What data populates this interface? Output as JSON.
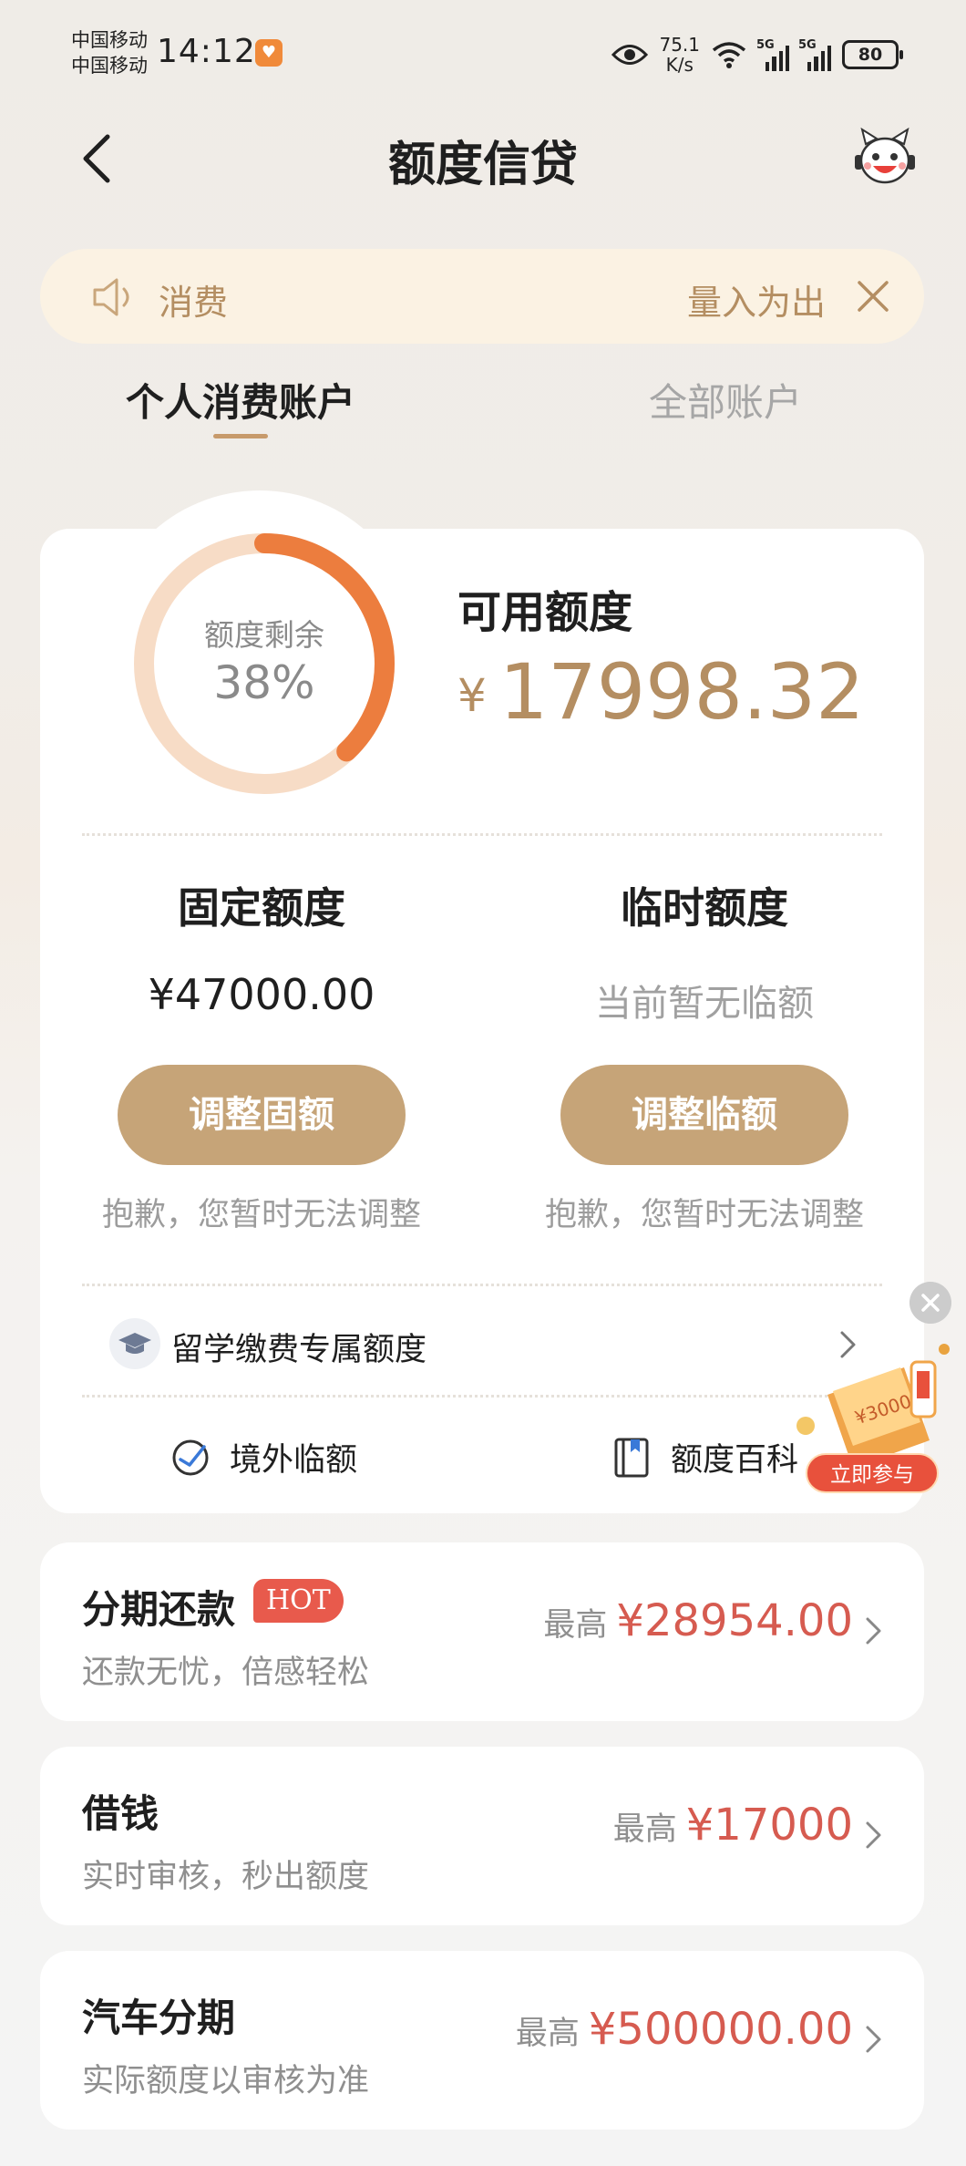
{
  "status_bar": {
    "carrier_1": "中国移动",
    "carrier_2": "中国移动",
    "time": "14:12",
    "net_speed_value": "75.1",
    "net_speed_unit": "K/s",
    "signal_1_label": "5G",
    "signal_2_label": "5G",
    "battery": "80"
  },
  "header": {
    "title": "额度信贷"
  },
  "notice": {
    "left_text": "消费",
    "right_text": "量入为出"
  },
  "tabs": [
    {
      "label": "个人消费账户",
      "active": true
    },
    {
      "label": "全部账户",
      "active": false
    }
  ],
  "credit": {
    "ring_label": "额度剩余",
    "ring_value": "38%",
    "remaining_fraction": 0.38,
    "available_label": "可用额度",
    "available_currency": "¥",
    "available_amount": "17998.32",
    "fixed": {
      "title": "固定额度",
      "value": "¥47000.00",
      "button": "调整固额",
      "note": "抱歉，您暂时无法调整"
    },
    "temporary": {
      "title": "临时额度",
      "value": "当前暂无临额",
      "button": "调整临额",
      "note": "抱歉，您暂时无法调整"
    },
    "study_label": "留学缴费专属额度",
    "tools": [
      {
        "label": "境外临额",
        "icon": "globe-plane-icon"
      },
      {
        "label": "额度百科",
        "icon": "book-icon"
      }
    ]
  },
  "promo": {
    "button": "立即参与",
    "coupon_text": "¥3000"
  },
  "products": [
    {
      "title": "分期还款",
      "badge": "HOT",
      "subtitle": "还款无忧，倍感轻松",
      "prefix": "最高",
      "amount": "¥28954.00"
    },
    {
      "title": "借钱",
      "badge": "",
      "subtitle": "实时审核，秒出额度",
      "prefix": "最高",
      "amount": "¥17000"
    },
    {
      "title": "汽车分期",
      "badge": "",
      "subtitle": "实际额度以审核为准",
      "prefix": "最高",
      "amount": "¥500000.00"
    }
  ],
  "colors": {
    "accent_gold": "#c6a478",
    "amount_gold": "#b48e62",
    "ring_orange": "#ec7d3e",
    "ring_track": "#f7dcc6",
    "amount_red": "#d65b50",
    "hot_red": "#e85a4c"
  }
}
